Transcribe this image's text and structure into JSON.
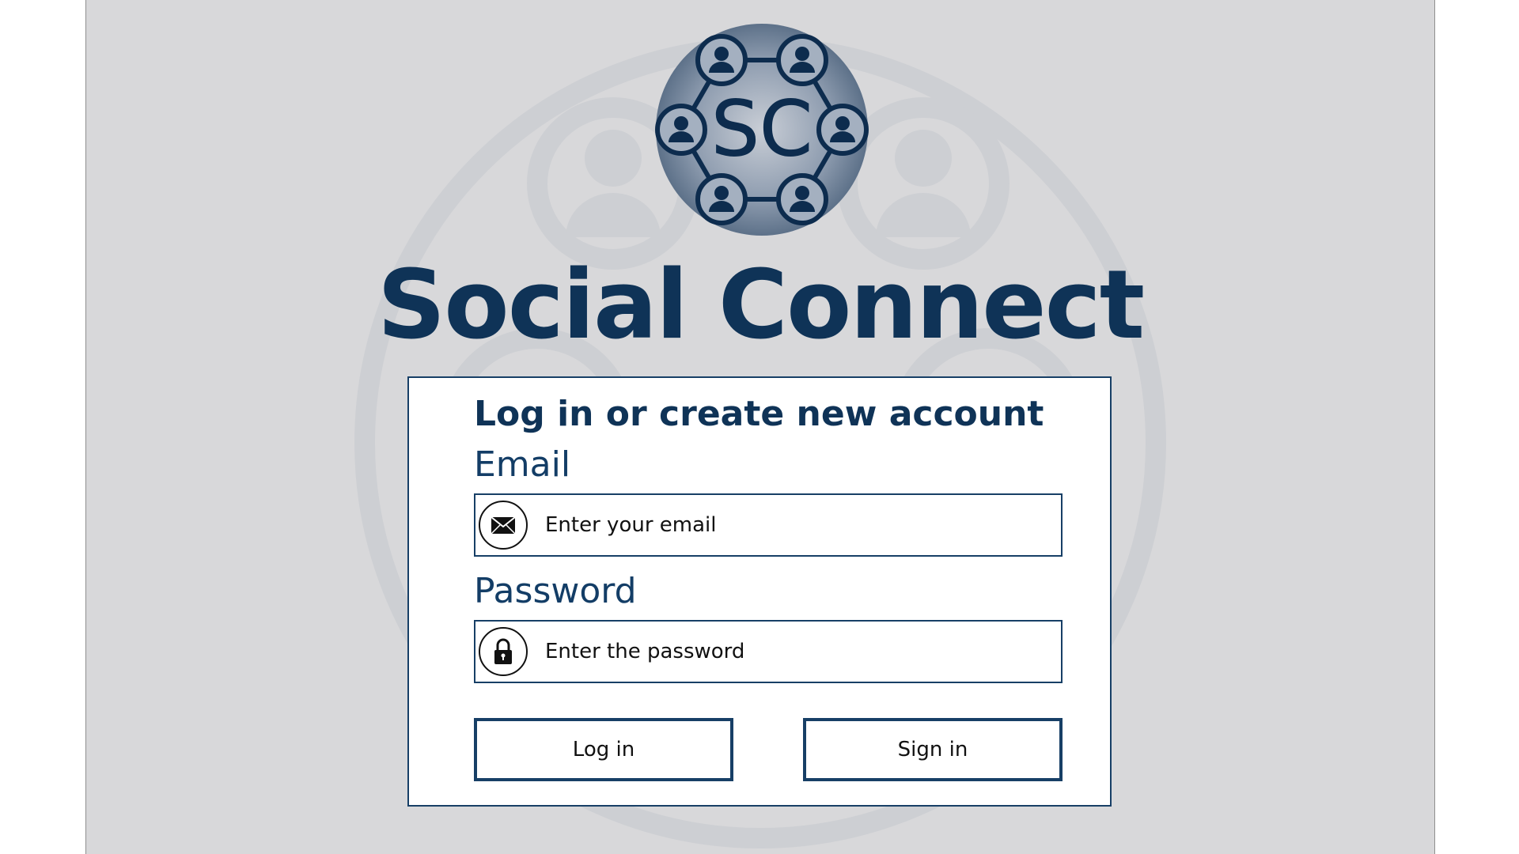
{
  "app": {
    "title": "Social Connect",
    "logo_text": "SC"
  },
  "login": {
    "heading": "Log in or create new account",
    "email": {
      "label": "Email",
      "placeholder": "Enter your email",
      "value": "",
      "icon": "envelope-icon"
    },
    "password": {
      "label": "Password",
      "placeholder": "Enter the password",
      "value": "",
      "icon": "lock-icon"
    },
    "buttons": {
      "login_label": "Log in",
      "signin_label": "Sign in"
    }
  },
  "colors": {
    "brand": "#0f3357",
    "border": "#173f66",
    "background": "#d8d8da",
    "card": "#ffffff"
  }
}
